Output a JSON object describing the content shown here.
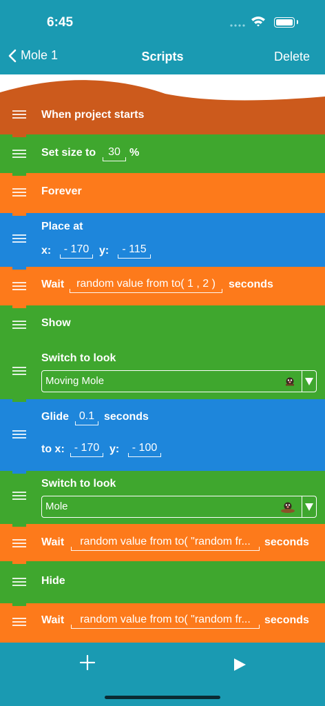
{
  "status": {
    "time": "6:45"
  },
  "nav": {
    "back_label": "Mole 1",
    "title": "Scripts",
    "right_label": "Delete"
  },
  "colors": {
    "header": "#1a9ab2",
    "event": "#cc5a1c",
    "looks": "#3fa72e",
    "control": "#fd7a1b",
    "motion": "#1e86db"
  },
  "blocks": {
    "when_starts": {
      "label": "When project starts"
    },
    "set_size": {
      "label": "Set size to",
      "value": "30",
      "unit": "%"
    },
    "forever": {
      "label": "Forever"
    },
    "place_at": {
      "label": "Place at",
      "x_label": "x:",
      "x_value": "- 170",
      "y_label": "y:",
      "y_value": "- 115"
    },
    "wait1": {
      "label": "Wait",
      "value": "random value from to( 1 , 2 )",
      "unit": "seconds"
    },
    "show": {
      "label": "Show"
    },
    "switch1": {
      "label": "Switch to look",
      "selected": "Moving Mole",
      "icon": "mole-icon"
    },
    "glide": {
      "label": "Glide",
      "value": "0.1",
      "unit": "seconds",
      "x_label": "to x:",
      "x_value": "- 170",
      "y_label": "y:",
      "y_value": "- 100"
    },
    "switch2": {
      "label": "Switch to look",
      "selected": "Mole",
      "icon": "mole-icon"
    },
    "wait2": {
      "label": "Wait",
      "value": "random value from to( \"random fr...",
      "unit": "seconds"
    },
    "hide": {
      "label": "Hide"
    },
    "wait3": {
      "label": "Wait",
      "value": "random value from to( \"random fr...",
      "unit": "seconds"
    }
  },
  "toolbar": {
    "add_icon": "plus-icon",
    "play_icon": "play-icon"
  }
}
